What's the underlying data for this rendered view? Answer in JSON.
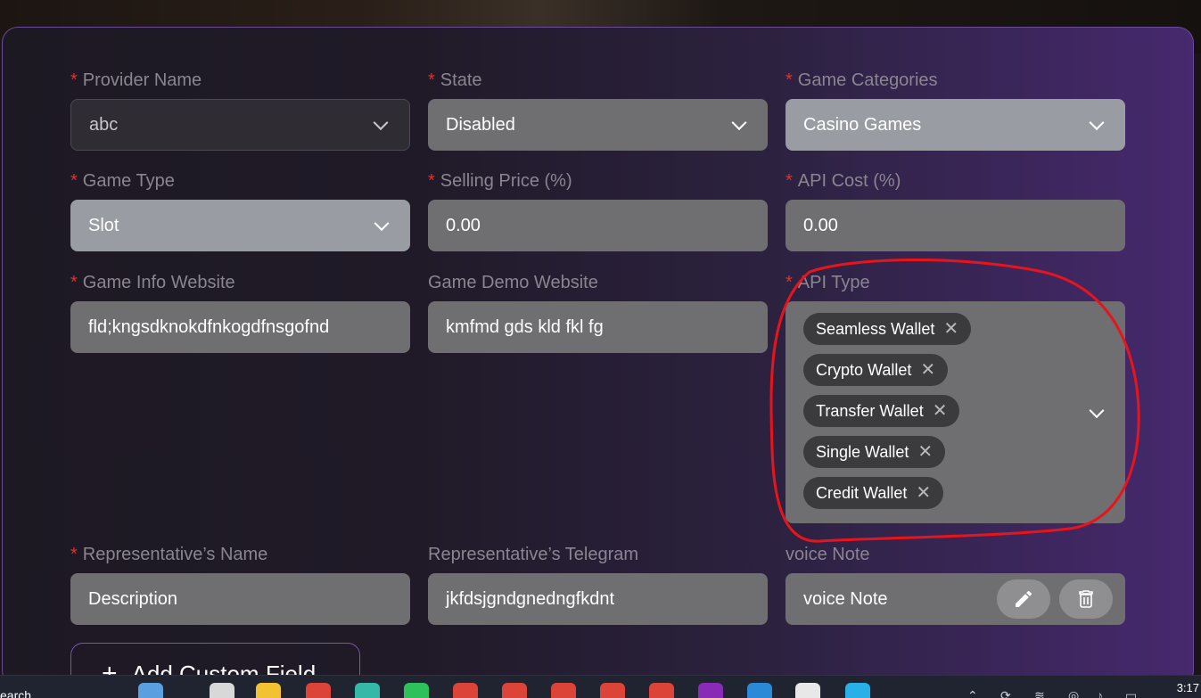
{
  "form": {
    "provider_name": {
      "label": "Provider Name",
      "value": "abc"
    },
    "state": {
      "label": "State",
      "value": "Disabled"
    },
    "game_categories": {
      "label": "Game Categories",
      "value": "Casino Games"
    },
    "game_type": {
      "label": "Game Type",
      "value": "Slot"
    },
    "selling_price": {
      "label": "Selling Price (%)",
      "value": "0.00"
    },
    "api_cost": {
      "label": "API Cost (%)",
      "value": "0.00"
    },
    "game_info_website": {
      "label": "Game Info Website",
      "value": "fld;kngsdknokdfnkogdfnsgofnd"
    },
    "game_demo_website": {
      "label": "Game Demo Website",
      "value": "kmfmd gds kld fkl fg"
    },
    "api_type": {
      "label": "API Type",
      "tags": [
        "Seamless Wallet",
        "Crypto Wallet",
        "Transfer Wallet",
        "Single Wallet",
        "Credit Wallet"
      ]
    },
    "rep_name": {
      "label": "Representative’s Name",
      "value": "Description"
    },
    "rep_telegram": {
      "label": "Representative’s Telegram",
      "value": "jkfdsjgndgnedngfkdnt"
    },
    "voice_note": {
      "label": "voice Note",
      "value": "voice Note"
    },
    "required_mark": "*",
    "tag_remove_glyph": "✕",
    "add_custom_field": "Add Custom Field"
  },
  "taskbar": {
    "search_text": "earch",
    "time": "3:17"
  },
  "colors": {
    "accent_purple": "#46296e",
    "required_red": "#e0322c",
    "annotation_red": "#e8141c"
  }
}
